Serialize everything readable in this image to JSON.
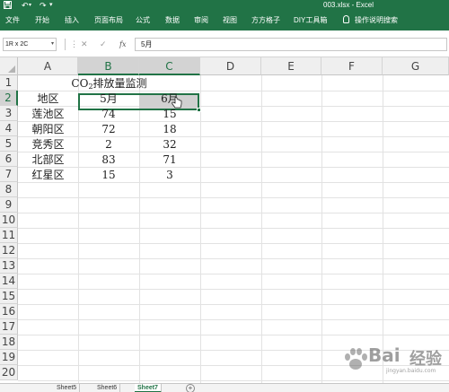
{
  "title_bar": {
    "title": "003.xlsx - Excel",
    "save_icon": "save-icon",
    "undo_icon": "undo-icon",
    "redo_icon": "redo-icon",
    "customize_icon": "customize-qat-icon"
  },
  "ribbon": {
    "tabs": [
      "文件",
      "开始",
      "插入",
      "页面布局",
      "公式",
      "数据",
      "审阅",
      "视图",
      "方方格子",
      "DIY工具箱"
    ],
    "tell_me": "操作说明搜索",
    "tell_me_icon": "lightbulb-icon"
  },
  "formula_bar": {
    "name_box": "1R x 2C",
    "fx_label": "fx",
    "cancel_icon": "close-icon",
    "enter_icon": "check-icon",
    "content": "5月"
  },
  "grid": {
    "columns": [
      "A",
      "B",
      "C",
      "D",
      "E",
      "F",
      "G"
    ],
    "rows": [
      "1",
      "2",
      "3",
      "4",
      "5",
      "6",
      "7",
      "8",
      "9",
      "10",
      "11",
      "12",
      "13",
      "14",
      "15",
      "16",
      "17",
      "18",
      "19",
      "20"
    ],
    "selected_columns": [
      "B",
      "C"
    ],
    "selected_row": "2",
    "title_prefix": "CO",
    "title_sub": "2",
    "title_suffix": "排放量监测",
    "header_row": [
      "地区",
      "5月",
      "6月"
    ],
    "data_rows": [
      [
        "莲池区",
        "74",
        "15"
      ],
      [
        "朝阳区",
        "72",
        "18"
      ],
      [
        "竞秀区",
        "2",
        "32"
      ],
      [
        "北部区",
        "83",
        "71"
      ],
      [
        "红星区",
        "15",
        "3"
      ]
    ]
  },
  "sheets": {
    "tabs": [
      "Sheet5",
      "Sheet6",
      "Sheet7"
    ],
    "active": "Sheet7",
    "add_icon": "add-sheet-icon"
  },
  "watermark": {
    "brand": "Bai",
    "brand_cn": "经验",
    "url": "jingyan.baidu.com"
  },
  "colors": {
    "accent": "#217346",
    "selection_fill": "#d0d0d0"
  }
}
